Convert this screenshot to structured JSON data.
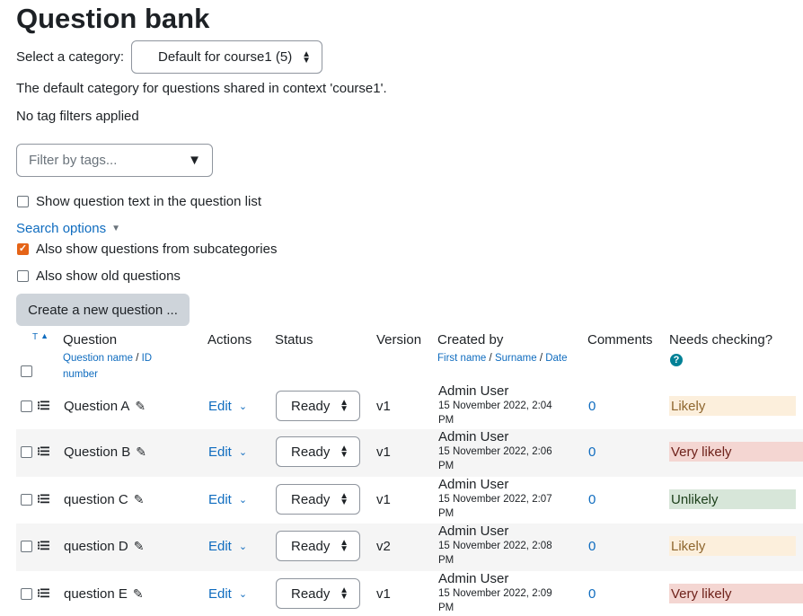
{
  "page": {
    "title": "Question bank"
  },
  "category": {
    "label": "Select a category:",
    "value": "Default for course1 (5)",
    "description": "The default category for questions shared in context 'course1'."
  },
  "tags": {
    "status": "No tag filters applied",
    "placeholder": "Filter by tags..."
  },
  "options": {
    "show_text_label": "Show question text in the question list",
    "show_text_checked": false,
    "search_options_label": "Search options",
    "subcategories_label": "Also show questions from subcategories",
    "subcategories_checked": true,
    "old_questions_label": "Also show old questions",
    "old_questions_checked": false
  },
  "create_button": "Create a new question ...",
  "table": {
    "col_type": "T",
    "col_question": "Question",
    "col_question_sub1": "Question name",
    "col_question_sep": "/",
    "col_question_sub2": "ID number",
    "col_actions": "Actions",
    "col_status": "Status",
    "col_version": "Version",
    "col_created": "Created by",
    "col_created_sub1": "First name",
    "col_created_sep1": "/",
    "col_created_sub2": "Surname",
    "col_created_sep2": "/",
    "col_created_sub3": "Date",
    "col_comments": "Comments",
    "col_needs": "Needs checking?",
    "rows": [
      {
        "name": "Question A",
        "action": "Edit",
        "status": "Ready",
        "version": "v1",
        "author": "Admin User",
        "date": "15 November 2022, 2:04",
        "date2": "PM",
        "comments": "0",
        "needs": "Likely",
        "needs_bg": "#fcefdc",
        "needs_color": "#8e662e"
      },
      {
        "name": "Question B",
        "action": "Edit",
        "status": "Ready",
        "version": "v1",
        "author": "Admin User",
        "date": "15 November 2022, 2:06",
        "date2": "PM",
        "comments": "0",
        "needs": "Very likely",
        "needs_bg": "#f4d6d2",
        "needs_color": "#6e211a"
      },
      {
        "name": "question C",
        "action": "Edit",
        "status": "Ready",
        "version": "v1",
        "author": "Admin User",
        "date": "15 November 2022, 2:07",
        "date2": "PM",
        "comments": "0",
        "needs": "Unlikely",
        "needs_bg": "#d7e6d9",
        "needs_color": "#1c3f1a"
      },
      {
        "name": "question D",
        "action": "Edit",
        "status": "Ready",
        "version": "v2",
        "author": "Admin User",
        "date": "15 November 2022, 2:08",
        "date2": "PM",
        "comments": "0",
        "needs": "Likely",
        "needs_bg": "#fcefdc",
        "needs_color": "#8e662e"
      },
      {
        "name": "question E",
        "action": "Edit",
        "status": "Ready",
        "version": "v1",
        "author": "Admin User",
        "date": "15 November 2022, 2:09",
        "date2": "PM",
        "comments": "0",
        "needs": "Very likely",
        "needs_bg": "#f4d6d2",
        "needs_color": "#6e211a"
      }
    ]
  },
  "colors": {
    "link": "#0f6cbf",
    "checkbox_checked": "#e56417",
    "help_icon": "#008196",
    "row_alt": "#f5f5f5"
  }
}
